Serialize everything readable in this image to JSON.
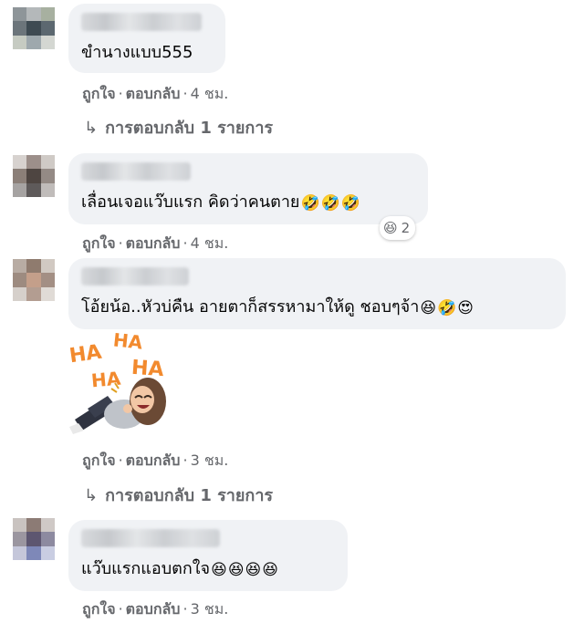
{
  "comments": [
    {
      "text": "ขำนางแบบ555",
      "emojis": [],
      "actions": {
        "like": "ถูกใจ",
        "reply": "ตอบกลับ",
        "time": "4 ชม."
      },
      "replies_link": "การตอบกลับ 1 รายการ"
    },
    {
      "text": "เลื่อนเจอแว๊บแรก คิดว่าคนตาย",
      "emojis": [
        "🤣",
        "🤣",
        "🤣"
      ],
      "reaction": {
        "emoji": "😆",
        "count": "2"
      },
      "actions": {
        "like": "ถูกใจ",
        "reply": "ตอบกลับ",
        "time": "4 ชม."
      }
    },
    {
      "text": "โอ้ยน้อ..หัวบ่คืน อายตาก็สรรหามาให้ดู ชอบๆจ้า",
      "emojis": [
        "😆",
        "🤣",
        "😍"
      ],
      "sticker": {
        "words": [
          "HA",
          "HA",
          "HA",
          "HA"
        ]
      },
      "actions": {
        "like": "ถูกใจ",
        "reply": "ตอบกลับ",
        "time": "3 ชม."
      },
      "replies_link": "การตอบกลับ 1 รายการ"
    },
    {
      "text": "แว๊บแรกแอบตกใจ",
      "emojis": [
        "😆",
        "😆",
        "😆",
        "😆"
      ],
      "actions": {
        "like": "ถูกใจ",
        "reply": "ตอบกลับ",
        "time": "3 ชม."
      }
    }
  ],
  "ui": {
    "separator": "·",
    "reply_arrow": "↳",
    "colors": {
      "bubble": "#f0f2f5",
      "meta": "#65676b",
      "text": "#050505"
    }
  }
}
